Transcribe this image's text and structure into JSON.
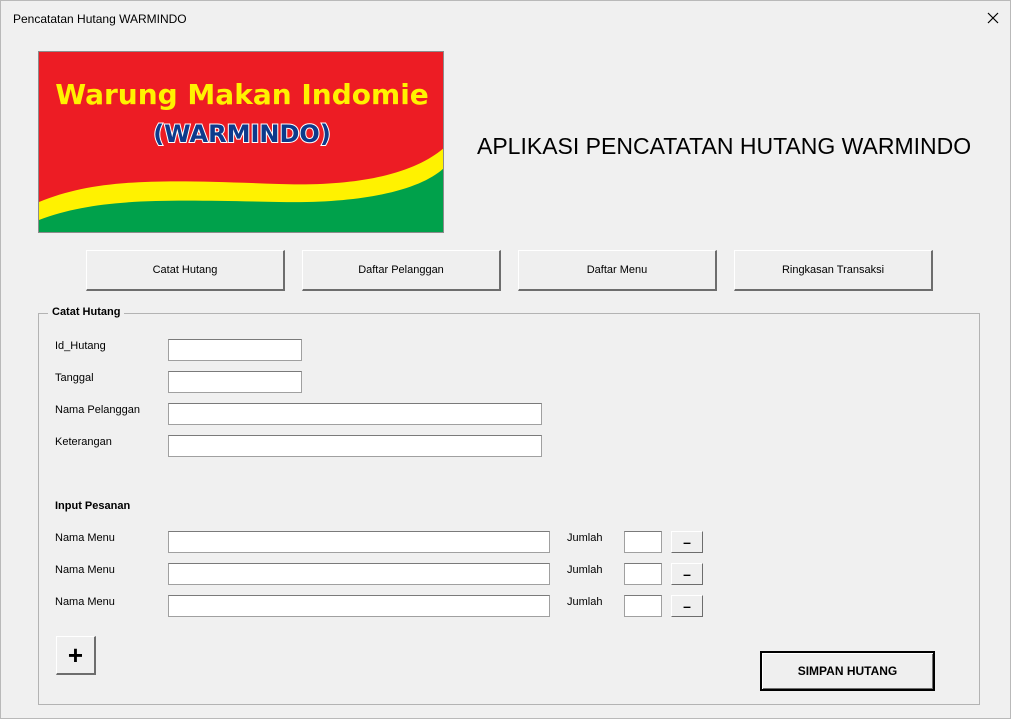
{
  "window": {
    "title": "Pencatatan Hutang WARMINDO",
    "close_icon": "close-icon"
  },
  "logo": {
    "line1": "Warung Makan Indomie",
    "line2": "(WARMINDO)",
    "colors": {
      "red": "#ed1c24",
      "yellow": "#fff200",
      "green": "#00a14b"
    }
  },
  "heading": "APLIKASI PENCATATAN HUTANG WARMINDO",
  "nav": {
    "catat_hutang": "Catat Hutang",
    "daftar_pelanggan": "Daftar Pelanggan",
    "daftar_menu": "Daftar Menu",
    "ringkasan_transaksi": "Ringkasan Transaksi"
  },
  "form": {
    "caption": "Catat Hutang",
    "id_hutang": {
      "label": "Id_Hutang",
      "value": ""
    },
    "tanggal": {
      "label": "Tanggal",
      "value": ""
    },
    "nama_pelanggan": {
      "label": "Nama Pelanggan",
      "value": ""
    },
    "keterangan": {
      "label": "Keterangan",
      "value": ""
    },
    "input_pesanan": "Input Pesanan",
    "orders": [
      {
        "menu_label": "Nama Menu",
        "menu_value": "",
        "jumlah_label": "Jumlah",
        "jumlah_value": "",
        "remove_label": "–"
      },
      {
        "menu_label": "Nama Menu",
        "menu_value": "",
        "jumlah_label": "Jumlah",
        "jumlah_value": "",
        "remove_label": "–"
      },
      {
        "menu_label": "Nama Menu",
        "menu_value": "",
        "jumlah_label": "Jumlah",
        "jumlah_value": "",
        "remove_label": "–"
      }
    ],
    "add_label": "+",
    "save_label": "SIMPAN HUTANG"
  }
}
